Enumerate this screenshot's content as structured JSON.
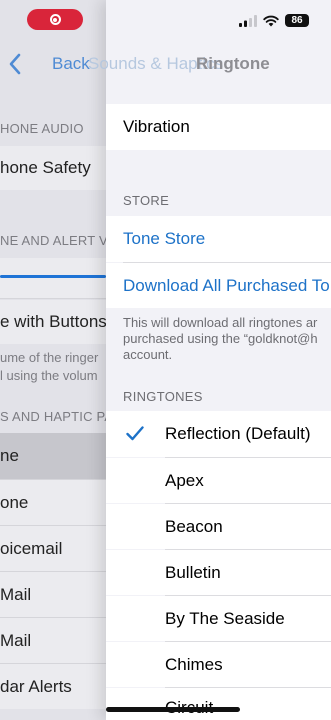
{
  "status_bar": {
    "battery": "86",
    "icons": [
      "signal-icon",
      "wifi-icon",
      "battery-icon"
    ],
    "recording_indicator": "screen-recording-icon"
  },
  "nav": {
    "back_label": "Back",
    "previous_title": "Sounds & Haptics",
    "title": "Ringtone"
  },
  "background_page": {
    "group1_label": "HONE AUDIO",
    "cell1": "hone Safety",
    "group2_label": "NE AND ALERT V",
    "cell2": "e with Buttons",
    "footer_line1": "ume of the ringer",
    "footer_line2": "l using the volum",
    "group3_label": "S AND HAPTIC PA",
    "items": [
      "ne",
      "one",
      "oicemail",
      "Mail",
      "Mail",
      "dar Alerts"
    ]
  },
  "vibration": {
    "label": "Vibration"
  },
  "store": {
    "header": "STORE",
    "tone_store": "Tone Store",
    "download_all": "Download All Purchased To",
    "footer_line1": "This will download all ringtones ar",
    "footer_line2": "purchased using the “goldknot@h",
    "footer_line3": "account."
  },
  "ringtones": {
    "header": "RINGTONES",
    "items": [
      "Reflection (Default)",
      "Apex",
      "Beacon",
      "Bulletin",
      "By The Seaside",
      "Chimes",
      "Circuit"
    ],
    "selected_index": 0
  },
  "colors": {
    "accent": "#1d72c8",
    "recording": "#d9253a",
    "group_bg": "#f2f2f7"
  }
}
